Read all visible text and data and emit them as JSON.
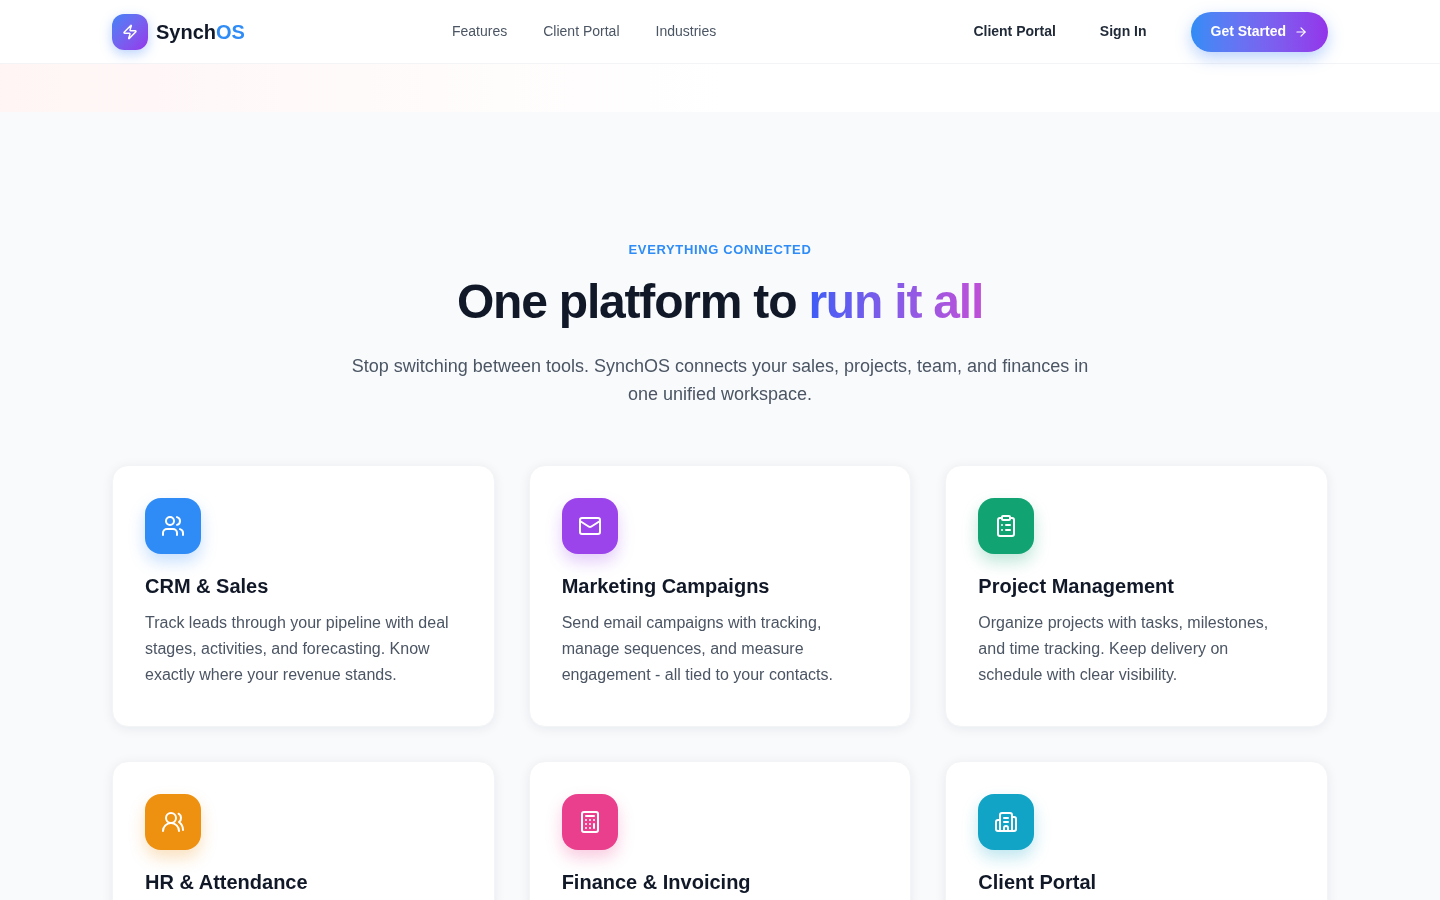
{
  "nav": {
    "brand_main": "Synch",
    "brand_accent": "OS",
    "links": [
      "Features",
      "Client Portal",
      "Industries"
    ],
    "secondary_links": [
      "Client Portal",
      "Sign In"
    ],
    "cta": "Get Started"
  },
  "hero": {
    "eyebrow": "EVERYTHING CONNECTED",
    "title_plain": "One platform to ",
    "title_highlight": "run it all",
    "subtitle": "Stop switching between tools. SynchOS connects your sales, projects, team, and finances in one unified workspace."
  },
  "features": [
    {
      "kind": "crm",
      "color": "#2f8cf6",
      "title": "CRM & Sales",
      "description": "Track leads through your pipeline with deal stages, activities, and forecasting. Know exactly where your revenue stands."
    },
    {
      "kind": "mail",
      "color": "#9b44ec",
      "title": "Marketing Campaigns",
      "description": "Send email campaigns with tracking, manage sequences, and measure engagement - all tied to your contacts."
    },
    {
      "kind": "clipboard",
      "color": "#11a472",
      "title": "Project Management",
      "description": "Organize projects with tasks, milestones, and time tracking. Keep delivery on schedule with clear visibility."
    },
    {
      "kind": "people",
      "color": "#ee9010",
      "title": "HR & Attendance"
    },
    {
      "kind": "calculator",
      "color": "#ea3f8c",
      "title": "Finance & Invoicing"
    },
    {
      "kind": "building",
      "color": "#11a4c6",
      "title": "Client Portal"
    }
  ]
}
